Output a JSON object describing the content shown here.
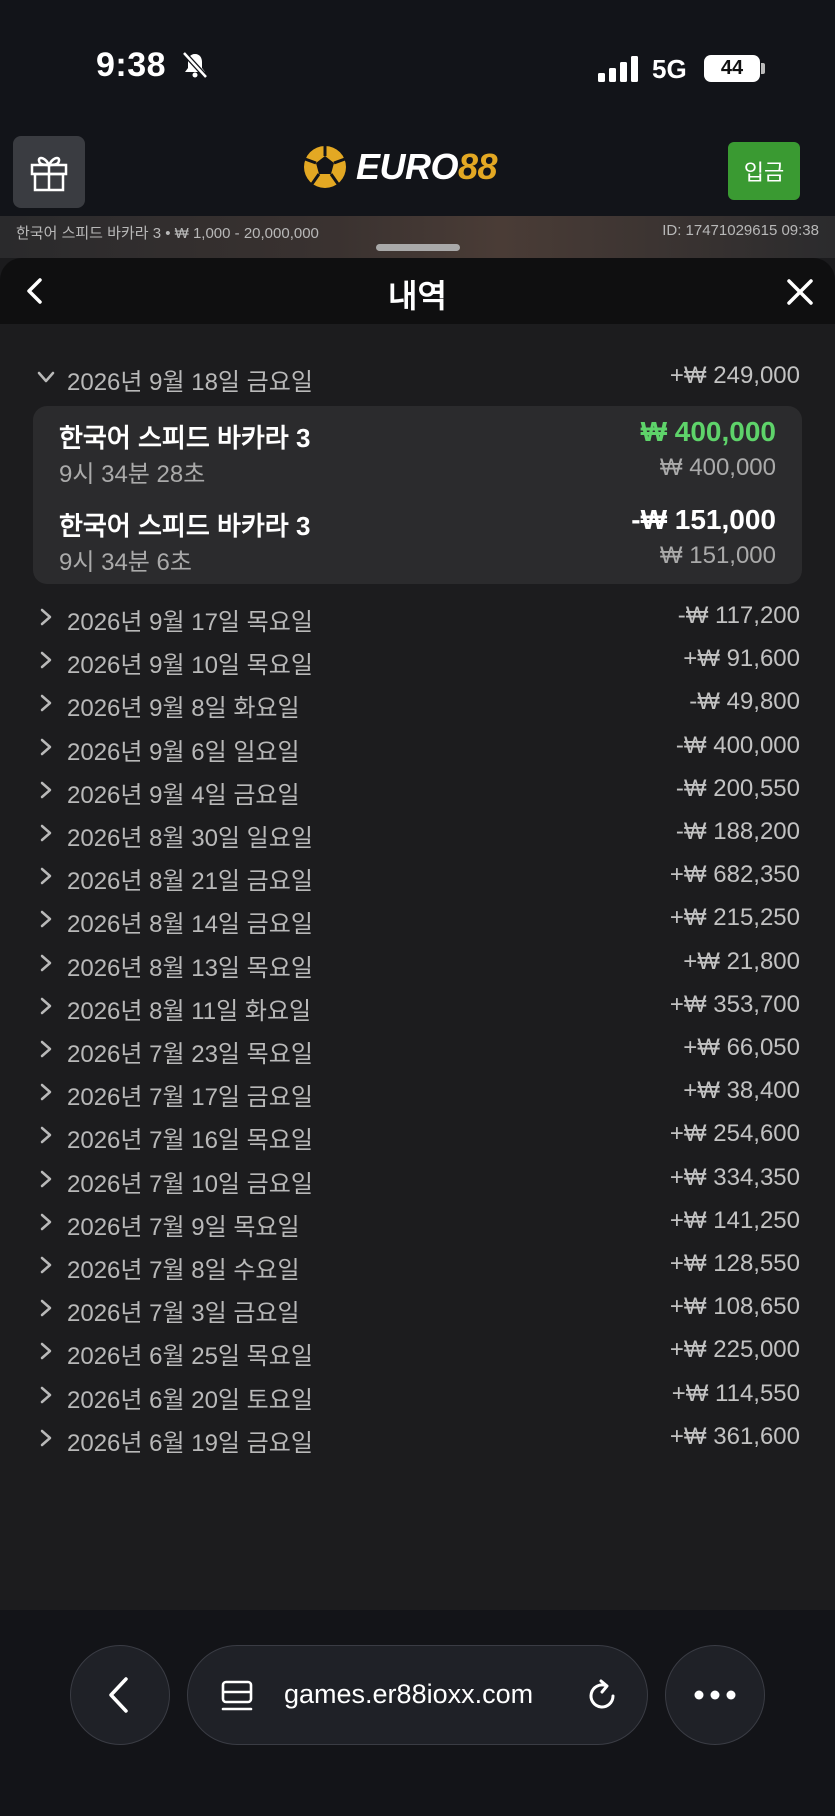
{
  "status_bar": {
    "time": "9:38",
    "network": "5G",
    "battery": "44"
  },
  "header": {
    "logo_text_white": "EURO",
    "logo_text_gold": "88",
    "deposit_label": "입금"
  },
  "game_info": {
    "left": "한국어 스피드 바카라 3 • ₩ 1,000 - 20,000,000",
    "right": "ID: 17471029615 09:38"
  },
  "panel": {
    "title": "내역"
  },
  "expanded_day": {
    "label": "2026년 9월 18일 금요일",
    "amount": "+₩ 249,000",
    "transactions": [
      {
        "name": "한국어 스피드 바카라 3",
        "time": "9시 34분 28초",
        "net": "₩ 400,000",
        "sub": "₩ 400,000",
        "net_color": "#5ed36a"
      },
      {
        "name": "한국어 스피드 바카라 3",
        "time": "9시 34분 6초",
        "net": "-₩ 151,000",
        "sub": "₩ 151,000",
        "net_color": "#ffffff"
      }
    ]
  },
  "days": [
    {
      "label": "2026년 9월 17일 목요일",
      "amount": "-₩ 117,200"
    },
    {
      "label": "2026년 9월 10일 목요일",
      "amount": "+₩ 91,600"
    },
    {
      "label": "2026년 9월 8일 화요일",
      "amount": "-₩ 49,800"
    },
    {
      "label": "2026년 9월 6일 일요일",
      "amount": "-₩ 400,000"
    },
    {
      "label": "2026년 9월 4일 금요일",
      "amount": "-₩ 200,550"
    },
    {
      "label": "2026년 8월 30일 일요일",
      "amount": "-₩ 188,200"
    },
    {
      "label": "2026년 8월 21일 금요일",
      "amount": "+₩ 682,350"
    },
    {
      "label": "2026년 8월 14일 금요일",
      "amount": "+₩ 215,250"
    },
    {
      "label": "2026년 8월 13일 목요일",
      "amount": "+₩ 21,800"
    },
    {
      "label": "2026년 8월 11일 화요일",
      "amount": "+₩ 353,700"
    },
    {
      "label": "2026년 7월 23일 목요일",
      "amount": "+₩ 66,050"
    },
    {
      "label": "2026년 7월 17일 금요일",
      "amount": "+₩ 38,400"
    },
    {
      "label": "2026년 7월 16일 목요일",
      "amount": "+₩ 254,600"
    },
    {
      "label": "2026년 7월 10일 금요일",
      "amount": "+₩ 334,350"
    },
    {
      "label": "2026년 7월 9일 목요일",
      "amount": "+₩ 141,250"
    },
    {
      "label": "2026년 7월 8일 수요일",
      "amount": "+₩ 128,550"
    },
    {
      "label": "2026년 7월 3일 금요일",
      "amount": "+₩ 108,650"
    },
    {
      "label": "2026년 6월 25일 목요일",
      "amount": "+₩ 225,000"
    },
    {
      "label": "2026년 6월 20일 토요일",
      "amount": "+₩ 114,550"
    },
    {
      "label": "2026년 6월 19일 금요일",
      "amount": "+₩ 361,600"
    }
  ],
  "browser": {
    "url": "games.er88ioxx.com"
  }
}
